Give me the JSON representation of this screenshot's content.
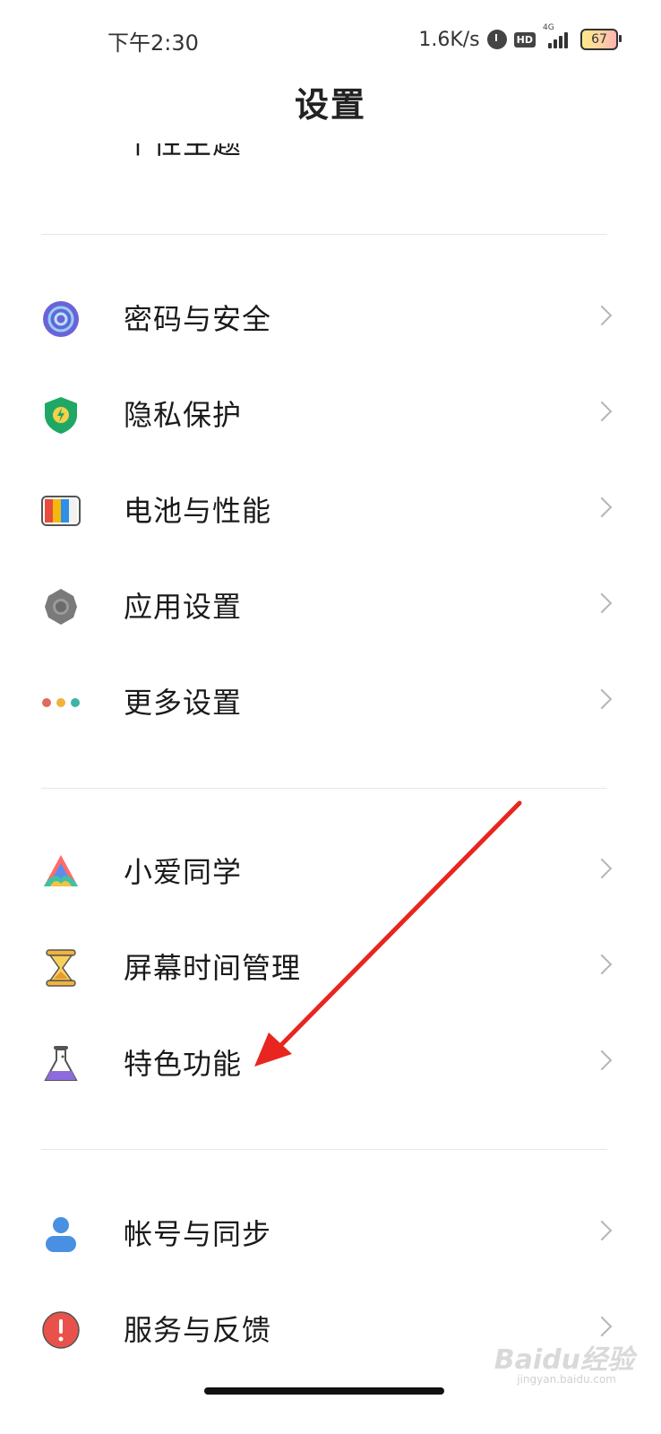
{
  "status_bar": {
    "time": "下午2:30",
    "network_speed": "1.6K/s",
    "hd_label": "HD",
    "network_type": "4G",
    "battery_level": "67",
    "icons": [
      "alarm-icon",
      "hd-icon",
      "signal-icon",
      "battery-icon"
    ]
  },
  "header": {
    "title": "设置"
  },
  "sections": [
    {
      "items": [
        {
          "label": "个性主题",
          "icon": "theme-icon",
          "clipped": true
        }
      ]
    },
    {
      "items": [
        {
          "label": "密码与安全",
          "icon": "password-security-icon",
          "color": "#6c63d8"
        },
        {
          "label": "隐私保护",
          "icon": "privacy-shield-icon",
          "color": "#1fa865"
        },
        {
          "label": "电池与性能",
          "icon": "battery-performance-icon",
          "color": "#e84c3d"
        },
        {
          "label": "应用设置",
          "icon": "app-settings-gear-icon",
          "color": "#7a7a7a"
        },
        {
          "label": "更多设置",
          "icon": "more-settings-dots-icon",
          "color": "#e06b5a"
        }
      ]
    },
    {
      "items": [
        {
          "label": "小爱同学",
          "icon": "xiaoai-icon",
          "color": "#ff6b6b"
        },
        {
          "label": "屏幕时间管理",
          "icon": "hourglass-icon",
          "color": "#f2b23b"
        },
        {
          "label": "特色功能",
          "icon": "flask-icon",
          "color": "#8e6bdc"
        }
      ]
    },
    {
      "items": [
        {
          "label": "帐号与同步",
          "icon": "account-icon",
          "color": "#4a90e2"
        },
        {
          "label": "服务与反馈",
          "icon": "feedback-icon",
          "color": "#e8524a"
        }
      ]
    }
  ],
  "annotation": {
    "type": "arrow",
    "color": "#e8261f",
    "target": "特色功能"
  },
  "watermark": {
    "text": "Baidu经验",
    "sub": "jingyan.baidu.com"
  }
}
